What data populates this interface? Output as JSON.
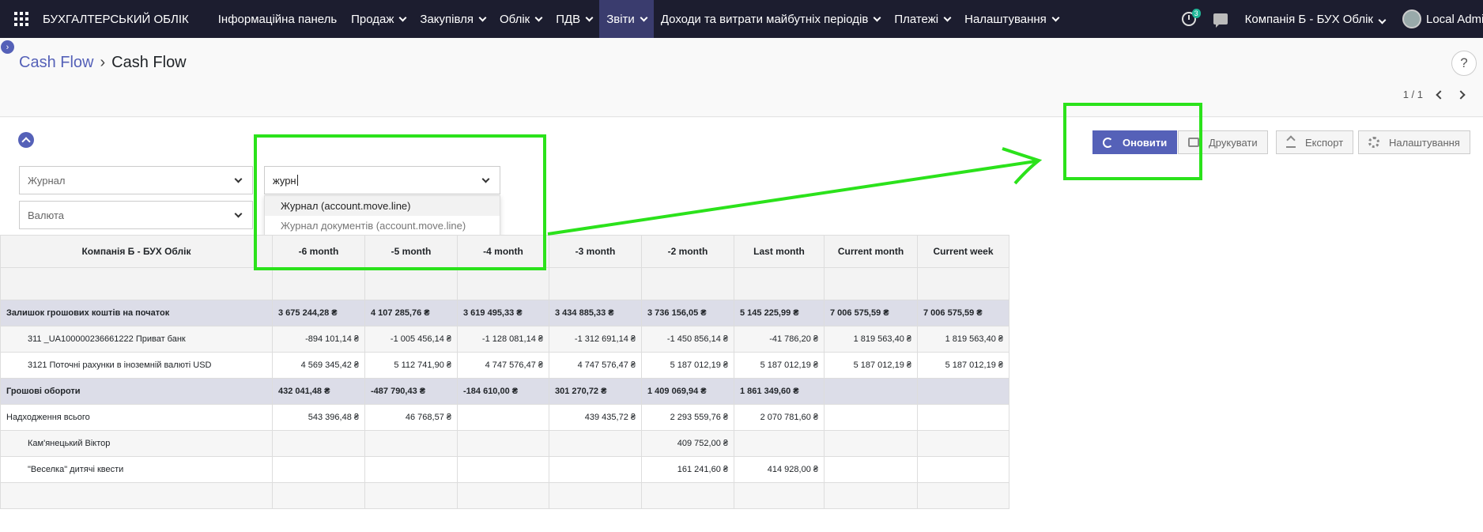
{
  "nav": {
    "brand": "БУХГАЛТЕРСЬКИЙ ОБЛІК",
    "menu": [
      {
        "label": "Інформаційна панель",
        "caret": false
      },
      {
        "label": "Продаж",
        "caret": true
      },
      {
        "label": "Закупівля",
        "caret": true
      },
      {
        "label": "Облік",
        "caret": true
      },
      {
        "label": "ПДВ",
        "caret": true
      },
      {
        "label": "Звіти",
        "caret": true,
        "active": true
      },
      {
        "label": "Доходи та витрати майбутніх періодів",
        "caret": true
      },
      {
        "label": "Платежі",
        "caret": true
      },
      {
        "label": "Налаштування",
        "caret": true
      }
    ],
    "activity_badge": "3",
    "company": "Компанія Б - БУХ Облік",
    "user": "Local Admin"
  },
  "control": {
    "breadcrumb_link": "Cash Flow",
    "breadcrumb_current": "Cash Flow",
    "help": "?",
    "pager": "1 / 1"
  },
  "filters": {
    "journal_placeholder": "Журнал",
    "currency_placeholder": "Валюта",
    "groupby_value": "журн",
    "options": [
      "Журнал (account.move.line)",
      "Журнал документів (account.move.line)"
    ]
  },
  "buttons": {
    "refresh": "Оновити",
    "print": "Друкувати",
    "export": "Експорт",
    "settings": "Налаштування"
  },
  "table": {
    "corner": "Компанія Б - БУХ Облік",
    "columns": [
      "-6 month",
      "-5 month",
      "-4 month",
      "-3 month",
      "-2 month",
      "Last month",
      "Current month",
      "Current week"
    ],
    "rows": [
      {
        "type": "group",
        "label": "Залишок грошових коштів на початок",
        "values": [
          "3 675 244,28 ₴",
          "4 107 285,76 ₴",
          "3 619 495,33 ₴",
          "3 434 885,33 ₴",
          "3 736 156,05 ₴",
          "5 145 225,99 ₴",
          "7 006 575,59 ₴",
          "7 006 575,59 ₴"
        ]
      },
      {
        "type": "alt",
        "indent": true,
        "label": "311 _UA100000236661222 Приват банк",
        "values": [
          "-894 101,14 ₴",
          "-1 005 456,14 ₴",
          "-1 128 081,14 ₴",
          "-1 312 691,14 ₴",
          "-1 450 856,14 ₴",
          "-41 786,20 ₴",
          "1 819 563,40 ₴",
          "1 819 563,40 ₴"
        ]
      },
      {
        "type": "row",
        "indent": true,
        "label": "3121 Поточні рахунки в іноземній валюті USD",
        "values": [
          "4 569 345,42 ₴",
          "5 112 741,90 ₴",
          "4 747 576,47 ₴",
          "4 747 576,47 ₴",
          "5 187 012,19 ₴",
          "5 187 012,19 ₴",
          "5 187 012,19 ₴",
          "5 187 012,19 ₴"
        ]
      },
      {
        "type": "group",
        "label": "Грошові обороти",
        "values": [
          "432 041,48 ₴",
          "-487 790,43 ₴",
          "-184 610,00 ₴",
          "301 270,72 ₴",
          "1 409 069,94 ₴",
          "1 861 349,60 ₴",
          "",
          ""
        ]
      },
      {
        "type": "row",
        "indent": false,
        "label": "Надходження всього",
        "values": [
          "543 396,48 ₴",
          "46 768,57 ₴",
          "",
          "439 435,72 ₴",
          "2 293 559,76 ₴",
          "2 070 781,60 ₴",
          "",
          ""
        ]
      },
      {
        "type": "alt",
        "indent": true,
        "label": "Кам'янецький Віктор",
        "values": [
          "",
          "",
          "",
          "",
          "409 752,00 ₴",
          "",
          "",
          ""
        ]
      },
      {
        "type": "row",
        "indent": true,
        "label": "\"Веселка\" дитячі квести",
        "values": [
          "",
          "",
          "",
          "",
          "161 241,60 ₴",
          "414 928,00 ₴",
          "",
          ""
        ]
      },
      {
        "type": "alt",
        "indent": true,
        "label": "",
        "values": [
          "",
          "",
          "",
          "",
          "",
          "",
          "",
          ""
        ]
      }
    ]
  },
  "colors": {
    "nav_bg": "#1c1d2f",
    "primary": "#5561b8",
    "group_row": "#dcdde8",
    "annotation": "#2be21b"
  }
}
